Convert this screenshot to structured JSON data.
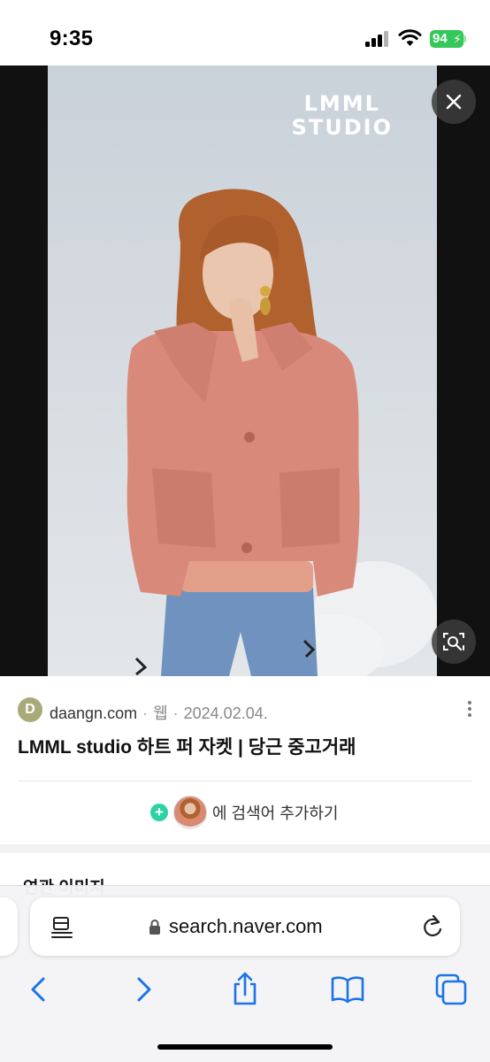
{
  "status_bar": {
    "time": "9:35",
    "battery": "94"
  },
  "viewer": {
    "brand_logo_line1": "LMML",
    "brand_logo_line2": "STUDIO",
    "close_icon": "close-icon",
    "lens_icon": "image-search-icon"
  },
  "result": {
    "favicon_letter": "D",
    "site": "daangn.com",
    "type": "웹",
    "date": "2024.02.04.",
    "title": "LMML studio 하트 퍼 자켓 | 당근 중고거래",
    "add_query_label": "에 검색어 추가하기"
  },
  "related": {
    "title": "연관 이미지"
  },
  "browser": {
    "url": "search.naver.com",
    "icons": [
      "reader-icon",
      "lock-icon",
      "reload-icon",
      "back-icon",
      "forward-icon",
      "share-icon",
      "bookmarks-icon",
      "tabs-icon"
    ]
  },
  "colors": {
    "accent_blue": "#1a73e8",
    "battery_green": "#34c759",
    "plus_green": "#2bd2a5",
    "coat_pink": "#d98a73"
  }
}
